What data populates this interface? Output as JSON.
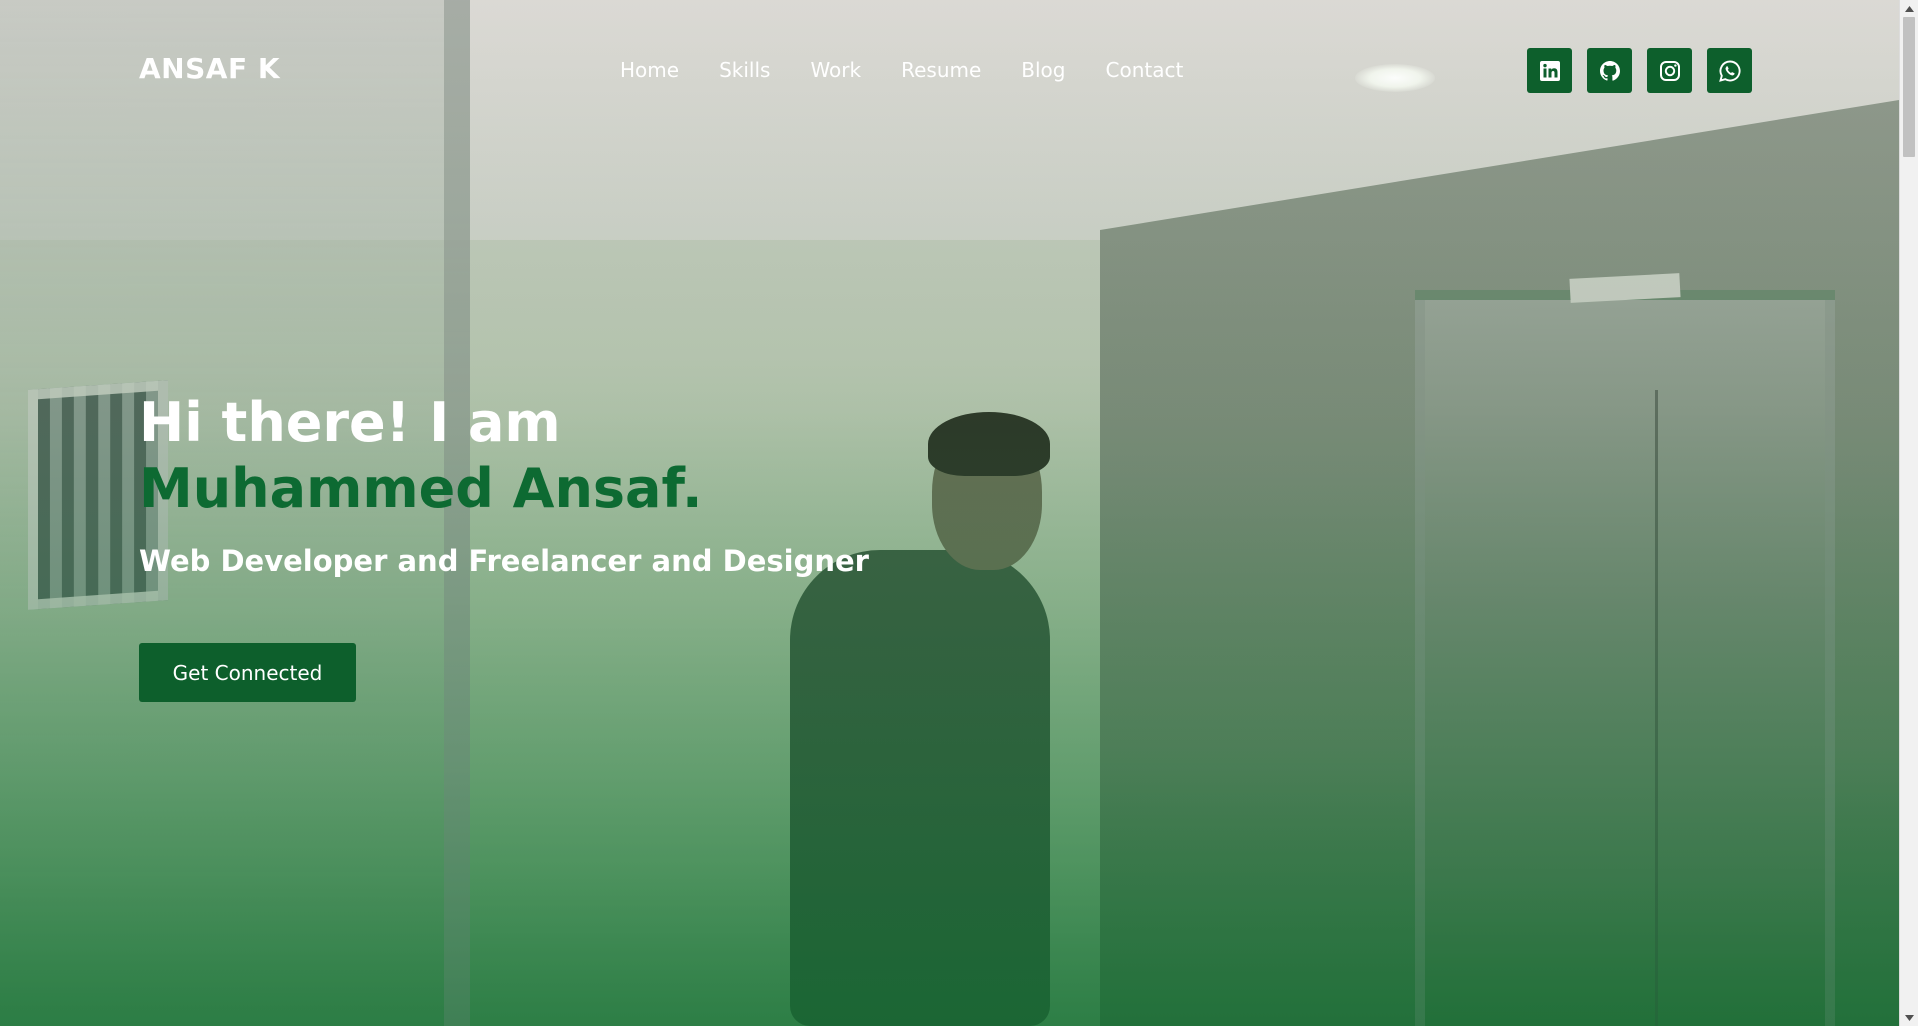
{
  "brand": {
    "name": "ANSAF K"
  },
  "nav": {
    "items": [
      {
        "label": "Home"
      },
      {
        "label": "Skills"
      },
      {
        "label": "Work"
      },
      {
        "label": "Resume"
      },
      {
        "label": "Blog"
      },
      {
        "label": "Contact"
      }
    ]
  },
  "socials": [
    {
      "icon": "linkedin-icon"
    },
    {
      "icon": "github-icon"
    },
    {
      "icon": "instagram-icon"
    },
    {
      "icon": "whatsapp-icon"
    }
  ],
  "hero": {
    "greeting": "Hi there! I am",
    "name": "Muhammed Ansaf.",
    "role": "Web Developer and Freelancer and Designer",
    "cta_label": "Get Connected"
  },
  "colors": {
    "accent_green": "#0d5f2c",
    "name_green": "#0d6a32",
    "text_white": "#ffffff"
  }
}
